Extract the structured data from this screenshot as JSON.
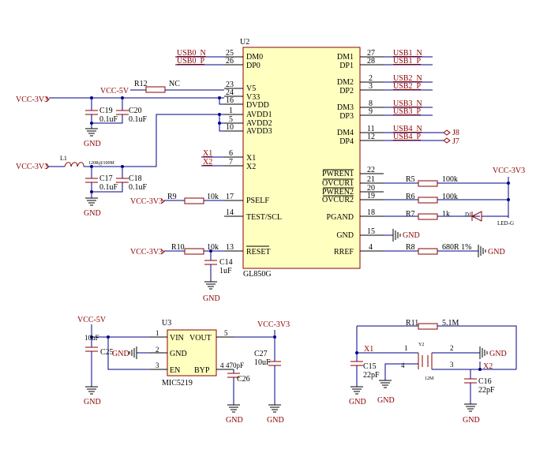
{
  "u2": {
    "designator": "U2",
    "part": "GL850G",
    "left_pins": [
      {
        "num": "25",
        "name": "DM0"
      },
      {
        "num": "26",
        "name": "DP0"
      },
      {
        "num": "23",
        "name": "V5"
      },
      {
        "num": "24",
        "name": "V33"
      },
      {
        "num": "16",
        "name": "DVDD"
      },
      {
        "num": "1",
        "name": "AVDD1"
      },
      {
        "num": "5",
        "name": "AVDD2"
      },
      {
        "num": "10",
        "name": "AVDD3"
      },
      {
        "num": "6",
        "name": "X1"
      },
      {
        "num": "7",
        "name": "X2"
      },
      {
        "num": "17",
        "name": "PSELF"
      },
      {
        "num": "14",
        "name": "TEST/SCL"
      },
      {
        "num": "13",
        "name": "RESET"
      }
    ],
    "right_pins": [
      {
        "num": "27",
        "name": "DM1"
      },
      {
        "num": "28",
        "name": "DP1"
      },
      {
        "num": "2",
        "name": "DM2"
      },
      {
        "num": "3",
        "name": "DP2"
      },
      {
        "num": "8",
        "name": "DM3"
      },
      {
        "num": "9",
        "name": "DP3"
      },
      {
        "num": "11",
        "name": "DM4"
      },
      {
        "num": "12",
        "name": "DP4"
      },
      {
        "num": "22",
        "name": "PWREN1"
      },
      {
        "num": "21",
        "name": "OVCUR1"
      },
      {
        "num": "20",
        "name": "PWREN2"
      },
      {
        "num": "19",
        "name": "OVCUR2"
      },
      {
        "num": "18",
        "name": "PGAND"
      },
      {
        "num": "15",
        "name": "GND"
      },
      {
        "num": "4",
        "name": "RREF"
      }
    ]
  },
  "nets": {
    "usb0_n": "USB0_N",
    "usb0_p": "USB0_P",
    "usb1_n": "USB1_N",
    "usb1_p": "USB1_P",
    "usb2_n": "USB2_N",
    "usb2_p": "USB2_P",
    "usb3_n": "USB3_N",
    "usb3_p": "USB3_P",
    "usb4_n": "USB4_N",
    "usb4_p": "USB4_P",
    "vcc3v3": "VCC-3V3",
    "vcc5v": "VCC-5V",
    "gnd": "GND",
    "x1": "X1",
    "x2": "X2"
  },
  "ports": {
    "j8": "J8",
    "j7": "J7"
  },
  "components": {
    "r12": {
      "ref": "R12",
      "value": "NC"
    },
    "c19": {
      "ref": "C19",
      "value": "0.1uF"
    },
    "c20": {
      "ref": "C20",
      "value": "0.1uF"
    },
    "l1": {
      "ref": "L1",
      "value": "120R@100M"
    },
    "c17": {
      "ref": "C17",
      "value": "0.1uF"
    },
    "c18": {
      "ref": "C18",
      "value": "0.1uF"
    },
    "r9": {
      "ref": "R9",
      "value": "10k"
    },
    "r10": {
      "ref": "R10",
      "value": "10k"
    },
    "c14": {
      "ref": "C14",
      "value": "1uF"
    },
    "r5": {
      "ref": "R5",
      "value": "100k"
    },
    "r6": {
      "ref": "R6",
      "value": "100k"
    },
    "r7": {
      "ref": "R7",
      "value": "1k"
    },
    "d1": {
      "ref": "D1",
      "value": "LED-G"
    },
    "r8": {
      "ref": "R8",
      "value": "680R 1%"
    },
    "u3": {
      "ref": "U3",
      "part": "MIC5219",
      "pins": [
        {
          "num": "1",
          "name": "VIN"
        },
        {
          "num": "5",
          "name": "VOUT"
        },
        {
          "num": "2",
          "name": "GND"
        },
        {
          "num": "3",
          "name": "EN"
        },
        {
          "num": "4",
          "name": "BYP"
        }
      ]
    },
    "c25": {
      "ref": "C25",
      "value": "10uF"
    },
    "c26": {
      "ref": "C26",
      "value": "470pF"
    },
    "c27": {
      "ref": "C27",
      "value": "10uF"
    },
    "r11": {
      "ref": "R11",
      "value": "5.1M"
    },
    "y2": {
      "ref": "Y2",
      "value": "12M",
      "pins": [
        "1",
        "2",
        "3",
        "4"
      ]
    },
    "c15": {
      "ref": "C15",
      "value": "22pF"
    },
    "c16": {
      "ref": "C16",
      "value": "22pF"
    }
  }
}
